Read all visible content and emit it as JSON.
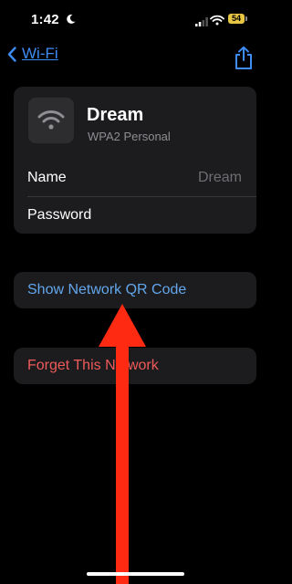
{
  "status_bar": {
    "time": "1:42",
    "battery": "54",
    "battery_color": "#e8c543"
  },
  "nav": {
    "back_label": "Wi-Fi",
    "share_icon": "share-icon"
  },
  "network": {
    "name": "Dream",
    "security": "WPA2 Personal",
    "rows": [
      {
        "label": "Name",
        "value": "Dream"
      },
      {
        "label": "Password",
        "value": ""
      }
    ]
  },
  "actions": {
    "show_qr": "Show Network QR Code",
    "forget": "Forget This Network"
  },
  "colors": {
    "background": "#000000",
    "card": "#1c1c1e",
    "accent_blue": "#3f8cf5",
    "destructive_red": "#ef5a5a",
    "annotation_arrow": "#ff2a12"
  }
}
